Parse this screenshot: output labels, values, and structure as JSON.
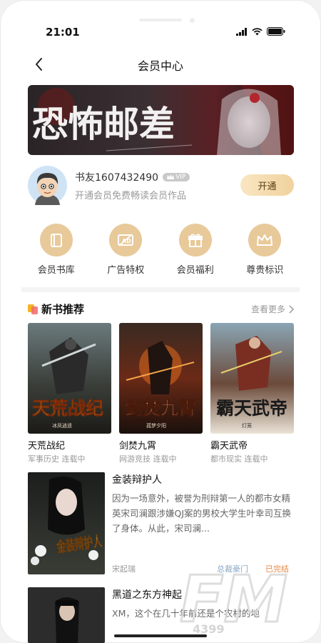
{
  "status_bar": {
    "time": "21:01"
  },
  "header": {
    "title": "会员中心"
  },
  "banner": {
    "headline": "恐怖邮差"
  },
  "user": {
    "name": "书友1607432490",
    "vip_badge": "VIP",
    "subtitle": "开通会员免费畅读会员作品",
    "open_button": "开通"
  },
  "features": [
    {
      "label": "会员书库",
      "icon": "book-icon"
    },
    {
      "label": "广告特权",
      "icon": "ad-icon"
    },
    {
      "label": "会员福利",
      "icon": "gift-icon"
    },
    {
      "label": "尊贵标识",
      "icon": "crown-icon"
    }
  ],
  "section": {
    "title": "新书推荐",
    "more": "查看更多"
  },
  "books": [
    {
      "title": "天荒战纪",
      "meta": "军事历史 连载中",
      "cover_title": "天荒战纪",
      "cover_author": "冰凤逍遥"
    },
    {
      "title": "剑焚九霄",
      "meta": "网游竞技 连载中",
      "cover_title": "剑焚九霄",
      "cover_author": "孤梦夕阳"
    },
    {
      "title": "霸天武帝",
      "meta": "都市现实 连载中",
      "cover_title": "霸天武帝",
      "cover_author": "灯笼"
    }
  ],
  "list": [
    {
      "title": "金装辩护人",
      "desc": "因为一场意外，被誉为刑辩第一人的都市女精英宋司澜跟涉嫌QJ案的男校大学生叶幸司互换了身体。从此，宋司澜...",
      "author": "宋起瑞",
      "tag1": "总裁豪门",
      "tag2": "已完结",
      "cover_title": "金装辩护人"
    },
    {
      "title": "黑道之东方神起",
      "desc": "XM，这个在几十年前还是个农村的地",
      "author": "",
      "tag1": "",
      "tag2": "",
      "cover_title": ""
    }
  ],
  "watermark": {
    "text": "FM",
    "sub": "4399"
  }
}
